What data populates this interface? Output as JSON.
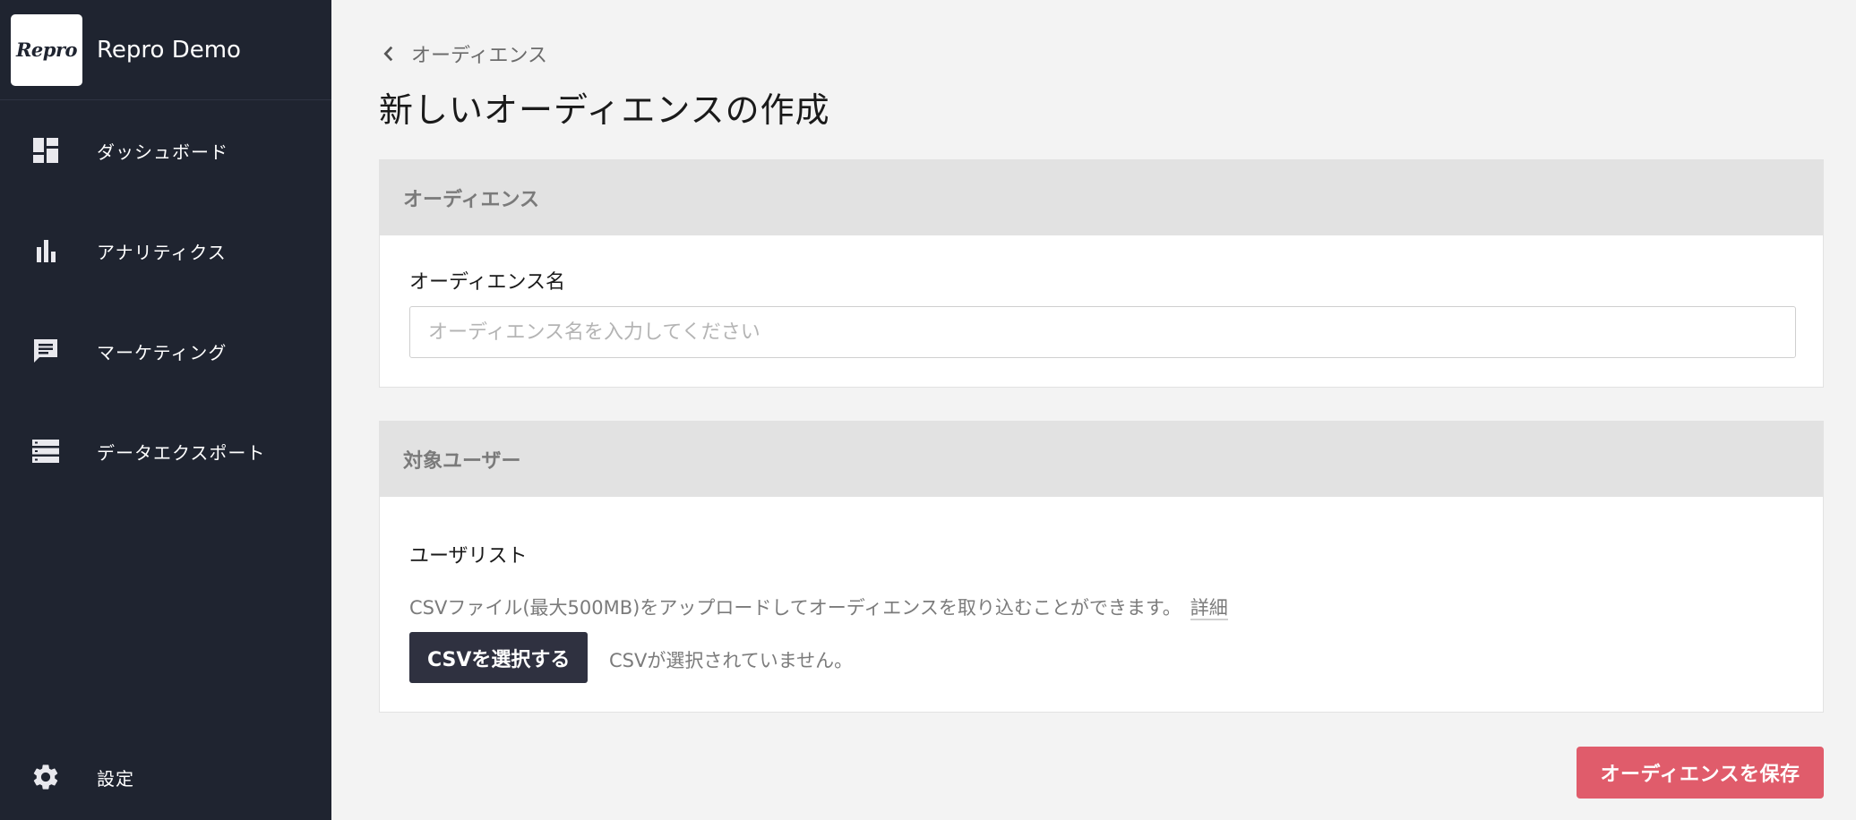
{
  "app": {
    "logo_text": "Repro",
    "name": "Repro Demo"
  },
  "sidebar": {
    "items": [
      {
        "label": "ダッシュボード",
        "icon": "dashboard-icon"
      },
      {
        "label": "アナリティクス",
        "icon": "bar-chart-icon"
      },
      {
        "label": "マーケティング",
        "icon": "message-icon"
      },
      {
        "label": "データエクスポート",
        "icon": "storage-icon"
      }
    ],
    "settings": {
      "label": "設定",
      "icon": "gear-icon"
    }
  },
  "breadcrumb": {
    "label": "オーディエンス",
    "icon": "chevron-left-icon"
  },
  "page": {
    "title": "新しいオーディエンスの作成"
  },
  "audience_section": {
    "header": "オーディエンス",
    "name_label": "オーディエンス名",
    "name_value": "",
    "name_placeholder": "オーディエンス名を入力してください"
  },
  "target_section": {
    "header": "対象ユーザー",
    "userlist_label": "ユーザリスト",
    "help_text": "CSVファイル(最大500MB)をアップロードしてオーディエンスを取り込むことができます。",
    "detail_link": "詳細",
    "select_button": "CSVを選択する",
    "file_status": "CSVが選択されていません。"
  },
  "actions": {
    "save_label": "オーディエンスを保存"
  },
  "colors": {
    "sidebar_bg": "#1f2430",
    "save_button": "#e05c6b",
    "csv_button": "#2f3140",
    "section_header_bg": "#e2e2e2"
  }
}
